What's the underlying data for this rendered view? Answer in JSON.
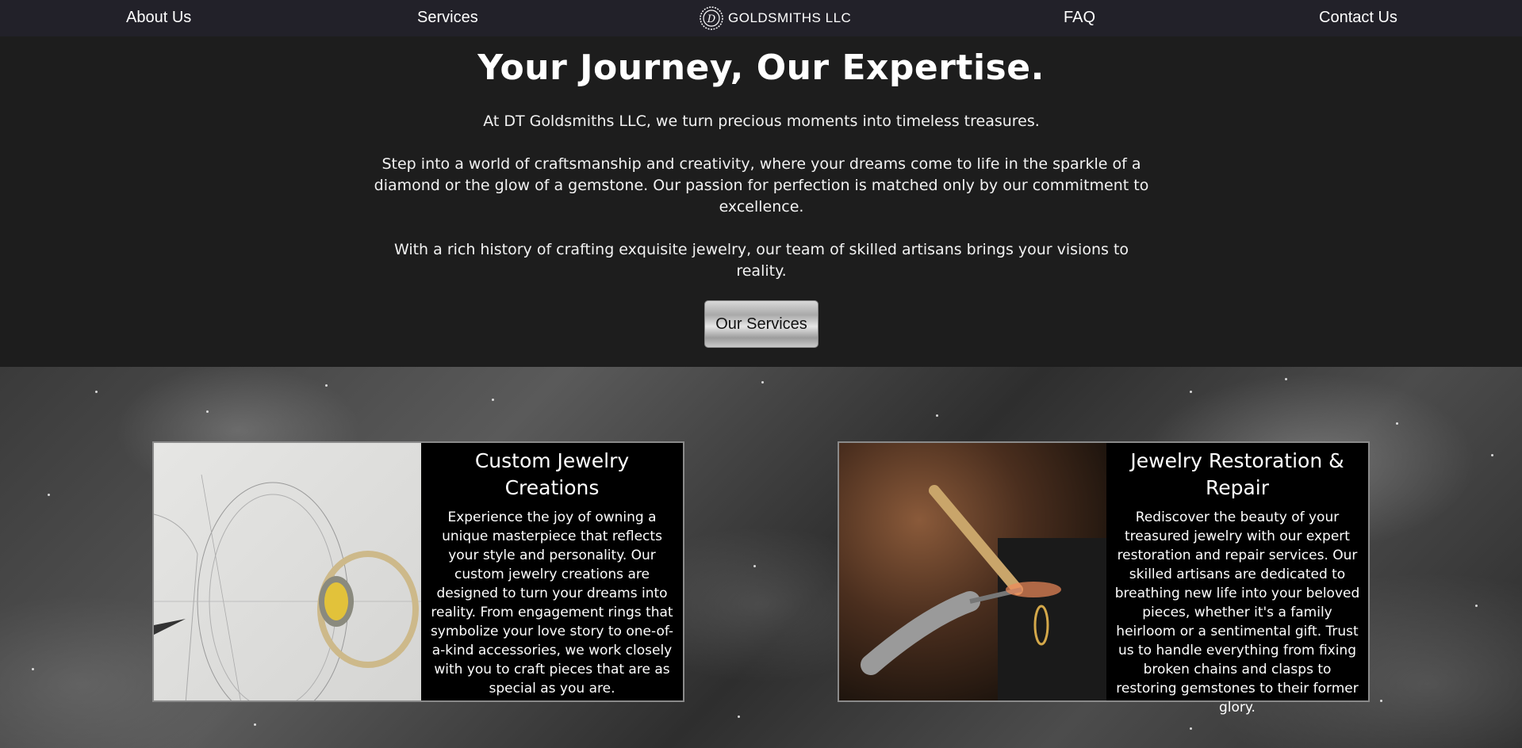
{
  "nav": {
    "about": "About Us",
    "services": "Services",
    "logo_text": "GOLDSMITHS LLC",
    "faq": "FAQ",
    "contact": "Contact Us"
  },
  "hero": {
    "title": "Your Journey, Our Expertise.",
    "p1": "At DT Goldsmiths LLC, we turn precious moments into timeless treasures.",
    "p2": "Step into a world of craftsmanship and creativity, where your dreams come to life in the sparkle of a diamond or the glow of a gemstone. Our passion for perfection is matched only by our commitment to excellence.",
    "p3": "With a rich history of crafting exquisite jewelry, our team of skilled artisans brings your visions to reality.",
    "button": "Our Services"
  },
  "cards": [
    {
      "title": "Custom Jewelry Creations",
      "text": "Experience the joy of owning a unique masterpiece that reflects your style and personality. Our custom jewelry creations are designed to turn your dreams into reality. From engagement rings that symbolize your love story to one-of-a-kind accessories, we work closely with you to craft pieces that are as special as you are."
    },
    {
      "title": "Jewelry Restoration & Repair",
      "text": "Rediscover the beauty of your treasured jewelry with our expert restoration and repair services. Our skilled artisans are dedicated to breathing new life into your beloved pieces, whether it's a family heirloom or a sentimental gift. Trust us to handle everything from fixing broken chains and clasps to restoring gemstones to their former glory."
    }
  ]
}
